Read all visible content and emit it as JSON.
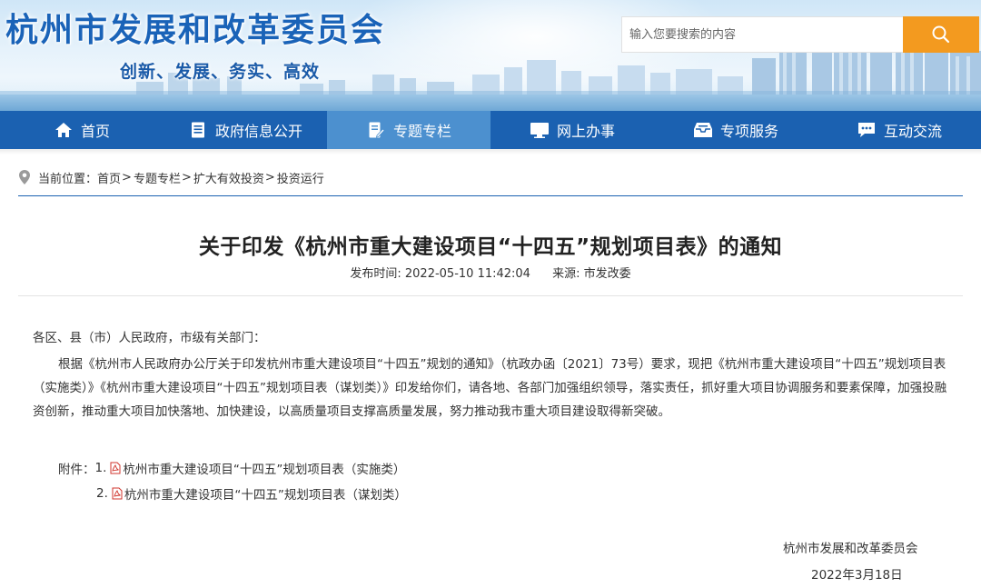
{
  "header": {
    "site_title": "杭州市发展和改革委员会",
    "slogan": "创新、发展、务实、高效",
    "search_placeholder": "输入您要搜索的内容",
    "search_icon": "search-icon"
  },
  "nav": {
    "items": [
      {
        "label": "首页",
        "icon": "home-icon"
      },
      {
        "label": "政府信息公开",
        "icon": "document-list-icon"
      },
      {
        "label": "专题专栏",
        "icon": "edit-document-icon",
        "active": true
      },
      {
        "label": "网上办事",
        "icon": "monitor-icon"
      },
      {
        "label": "专项服务",
        "icon": "inbox-icon"
      },
      {
        "label": "互动交流",
        "icon": "chat-icon"
      }
    ]
  },
  "breadcrumb": {
    "prefix": "当前位置：",
    "items": [
      "首页",
      "专题专栏",
      "扩大有效投资",
      "投资运行"
    ],
    "separator": ">"
  },
  "article": {
    "title": "关于印发《杭州市重大建设项目“十四五”规划项目表》的通知",
    "publish_time": "发布时间: 2022-05-10 11:42:04",
    "source": "来源: 市发改委",
    "salutation": "各区、县（市）人民政府，市级有关部门：",
    "body": "根据《杭州市人民政府办公厅关于印发杭州市重大建设项目“十四五”规划的通知》（杭政办函〔2021〕73号）要求，现把《杭州市重大建设项目“十四五”规划项目表（实施类）》《杭州市重大建设项目“十四五”规划项目表（谋划类）》印发给你们，请各地、各部门加强组织领导，落实责任，抓好重大项目协调服务和要素保障，加强投融资创新，推动重大项目加快落地、加快建设，以高质量项目支撑高质量发展，努力推动我市重大项目建设取得新突破。",
    "attachments_label": "附件：",
    "attachments": [
      {
        "num": "1.",
        "title": "杭州市重大建设项目“十四五”规划项目表（实施类）"
      },
      {
        "num": "2.",
        "title": "杭州市重大建设项目“十四五”规划项目表（谋划类）"
      }
    ],
    "signature_org": "杭州市发展和改革委员会",
    "signature_date": "2022年3月18日"
  },
  "colors": {
    "nav_bg": "#1b61b1",
    "nav_active": "#4c90cf",
    "search_button": "#f39a1f",
    "title_blue": "#1a63b8"
  }
}
